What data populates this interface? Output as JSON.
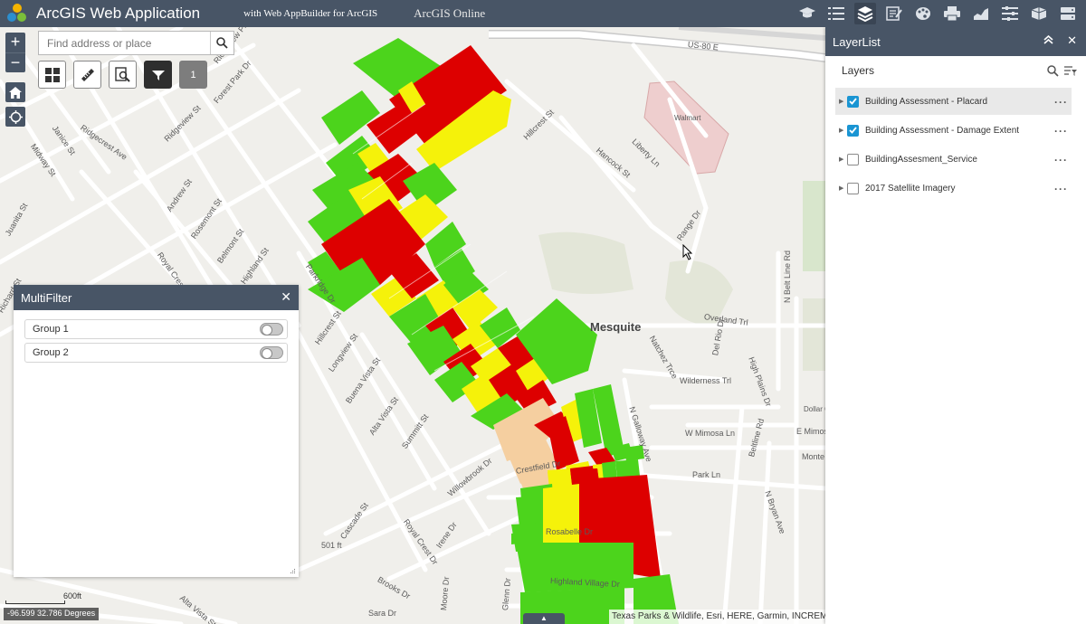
{
  "header": {
    "title": "ArcGIS Web Application",
    "subtitle": "with Web AppBuilder for ArcGIS",
    "online": "ArcGIS Online",
    "icons": [
      "graduation-cap-icon",
      "list-icon",
      "layers-icon",
      "edit-form-icon",
      "palette-icon",
      "print-icon",
      "chart-icon",
      "filter-list-icon",
      "basemap-icon",
      "server-icon"
    ]
  },
  "search": {
    "placeholder": "Find address or place"
  },
  "toolbar": {
    "badge": "1"
  },
  "map": {
    "place": "Mesquite",
    "streets": [
      "Ridgeview Plz",
      "Forest Park Dr",
      "Ridgecrest Ave",
      "Ridgeview St",
      "Janice St",
      "Midway St",
      "Juanita St",
      "Richard St",
      "Andrew St",
      "Rosemont St",
      "Belmont St",
      "Highland St",
      "Royal Crest Dr",
      "Parkridge Dr",
      "Hillcrest St",
      "Longview St",
      "Buena Vista St",
      "Alta Vista St",
      "Summitt St",
      "Willowbrook Dr",
      "Crestfield Dr",
      "Cascade St",
      "Royal Crest Dr",
      "Irene Dr",
      "Brooks Dr",
      "Sara Dr",
      "Moore Dr",
      "Glenn Dr",
      "Rosabelle Dr",
      "Highland Village Dr",
      "Alta Vista St",
      "Hillcrest St",
      "Hancock St",
      "Liberty Ln",
      "Range Dr",
      "Walmart",
      "Overland Trl",
      "Natchez Trce",
      "Del Rio Dr",
      "High Plains Dr",
      "Wilderness Trl",
      "N Galloway Ave",
      "W Mimosa Ln",
      "E Mimosa",
      "Park Ln",
      "N Bryan Ave",
      "Beltline Rd",
      "N Belt Line Rd",
      "US-80 E",
      "501 ft",
      "Dollar General",
      "Monte"
    ]
  },
  "multifilter": {
    "title": "MultiFilter",
    "groups": [
      {
        "label": "Group 1",
        "enabled": false
      },
      {
        "label": "Group 2",
        "enabled": false
      }
    ]
  },
  "layerlist": {
    "title": "LayerList",
    "subtitle": "Layers",
    "layers": [
      {
        "label": "Building Assessment - Placard",
        "checked": true,
        "selected": true
      },
      {
        "label": "Building Assessment - Damage Extent",
        "checked": true,
        "selected": false
      },
      {
        "label": "BuildingAssesment_Service",
        "checked": false,
        "selected": false
      },
      {
        "label": "2017 Satellite Imagery",
        "checked": false,
        "selected": false
      }
    ]
  },
  "footer": {
    "coords": "-96.599 32.786 Degrees",
    "scale": "600ft",
    "attribution": "Texas Parks & Wildlife, Esri, HERE, Garmin, INCREMENT P"
  },
  "colors": {
    "header": "#485566",
    "green": "#4cd41c",
    "yellow": "#f5f20a",
    "red": "#dd0000",
    "tan": "#f5cfa0",
    "check": "#1a95d3"
  }
}
